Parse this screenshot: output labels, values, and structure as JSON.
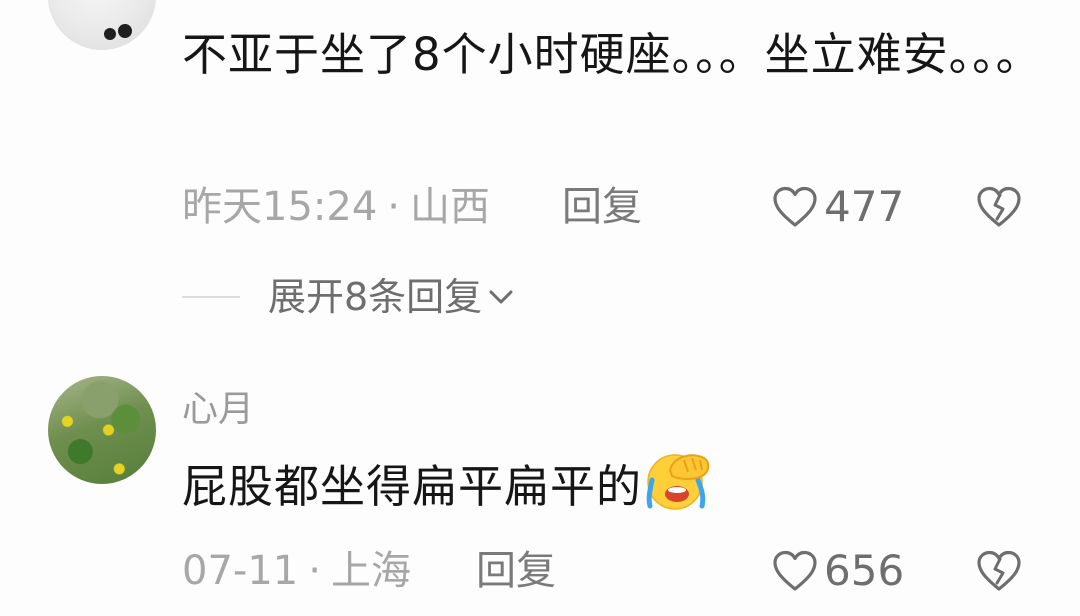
{
  "comments": [
    {
      "text": "不亚于坐了8个小时硬座。。。坐立难安。。。",
      "time": "昨天15:24",
      "location": "山西",
      "reply_label": "回复",
      "likes": "477",
      "expand_label": "展开8条回复"
    },
    {
      "username": "心月",
      "text": "屁股都坐得扁平扁平的",
      "emoji": "facepalm-laughing-emoji",
      "time": "07-11",
      "location": "上海",
      "reply_label": "回复",
      "likes": "656"
    }
  ],
  "meta_separator": "·",
  "icons": {
    "like": "heart-outline-icon",
    "dislike": "broken-heart-icon",
    "expand": "chevron-down-icon"
  },
  "colors": {
    "text": "#161616",
    "meta": "#a7a7a7",
    "username": "#9a9a9a"
  }
}
